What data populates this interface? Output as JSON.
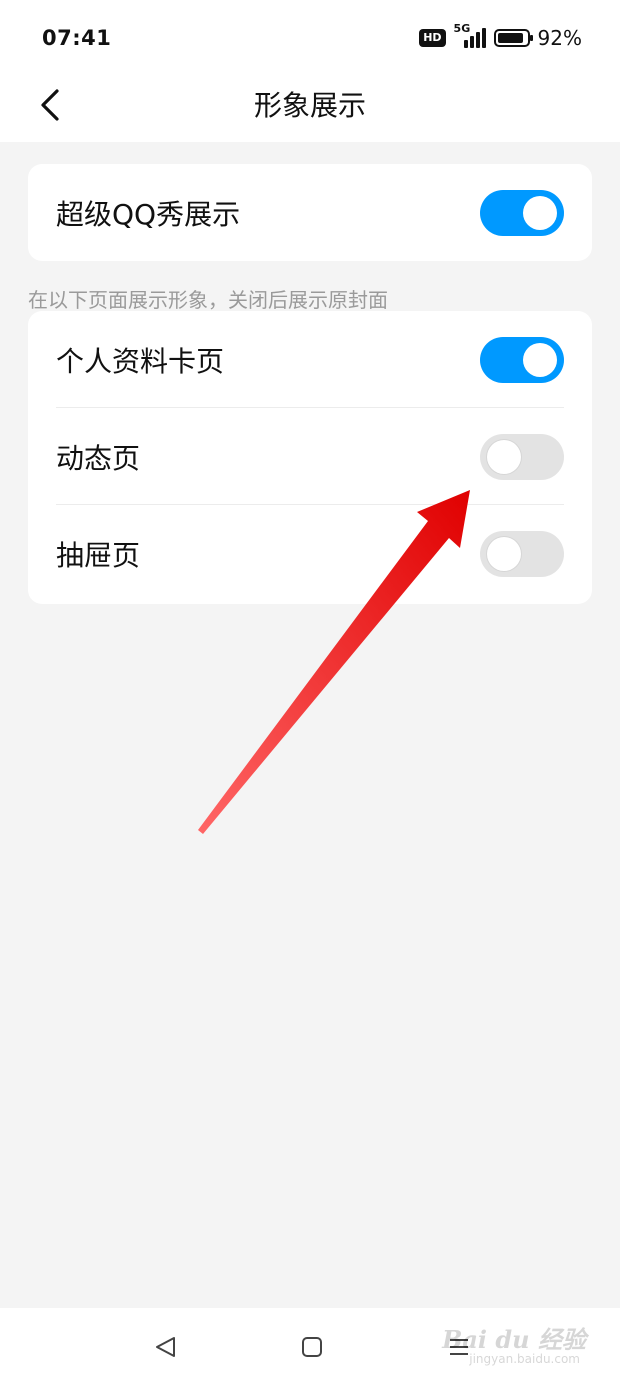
{
  "status_bar": {
    "time": "07:41",
    "hd_badge": "HD",
    "network": "5G",
    "battery_percent": "92%",
    "battery_level": 0.92
  },
  "nav": {
    "title": "形象展示",
    "back_icon": "chevron-left-icon"
  },
  "main_setting": {
    "label": "超级QQ秀展示",
    "enabled": true
  },
  "section_note": "在以下页面展示形象，关闭后展示原封面",
  "page_settings": [
    {
      "label": "个人资料卡页",
      "enabled": true
    },
    {
      "label": "动态页",
      "enabled": false
    },
    {
      "label": "抽屉页",
      "enabled": false
    }
  ],
  "colors": {
    "toggle_on": "#0099ff",
    "toggle_off": "#e3e3e3",
    "annotation_arrow": "#ee1111"
  },
  "system_nav": {
    "back_icon": "triangle-back-icon",
    "home_icon": "square-home-icon",
    "recents_icon": "menu-lines-icon"
  },
  "watermark": {
    "brand": "Bai du 经验",
    "url": "jingyan.baidu.com"
  }
}
